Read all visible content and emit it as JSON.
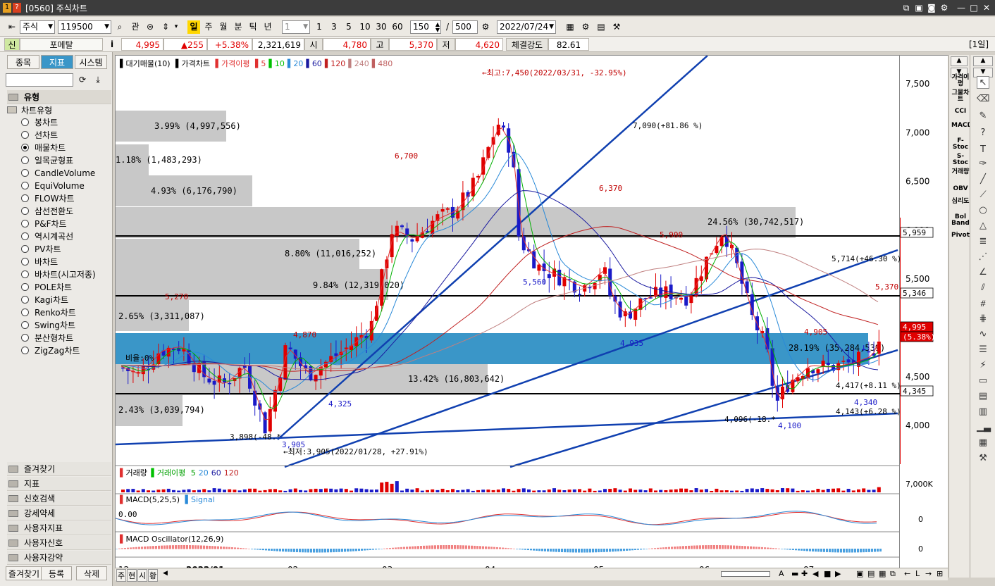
{
  "window": {
    "title": "[0560] 주식차트",
    "badge1": "1",
    "badge2": "?",
    "icons": [
      "restore-icon",
      "window-icon",
      "capture-icon",
      "settings-icon",
      "minimize",
      "maximize",
      "close"
    ]
  },
  "toolbar": {
    "market": "주식",
    "code": "119500",
    "search_btn": "관",
    "periods": [
      "일",
      "주",
      "월",
      "분",
      "틱",
      "년"
    ],
    "interval": "1",
    "quick": [
      "1",
      "3",
      "5",
      "10",
      "30",
      "60"
    ],
    "count": "150",
    "total": "500",
    "date": "2022/07/24"
  },
  "quote": {
    "badge": "신",
    "name": "포메탈",
    "info": "i",
    "price": "4,995",
    "change": "▲255",
    "pct": "+5.38%",
    "volume": "2,321,619",
    "open_label": "시",
    "open": "4,780",
    "high_label": "고",
    "high": "5,370",
    "low_label": "저",
    "low": "4,620",
    "strength_label": "체결강도",
    "strength": "82.61",
    "period_label": "[1일]"
  },
  "left": {
    "tabs": [
      "종목",
      "지표",
      "시스템"
    ],
    "section": "유형",
    "tree_label": "차트유형",
    "types": [
      "봉차트",
      "선차트",
      "매물차트",
      "일목균형표",
      "CandleVolume",
      "EquiVolume",
      "FLOW차트",
      "삼선전환도",
      "P&F차트",
      "역시계곡선",
      "PV차트",
      "바차트",
      "바차트(시고저종)",
      "POLE차트",
      "Kagi차트",
      "Renko차트",
      "Swing차트",
      "분산형차트",
      "ZigZag차트"
    ],
    "selected": "매물차트",
    "categories": [
      "즐겨찾기",
      "지표",
      "신호검색",
      "강세약세",
      "사용자지표",
      "사용자신호",
      "사용자강약"
    ],
    "bottom_tabs": [
      "즐겨찾기",
      "등록",
      "삭제"
    ]
  },
  "legend": {
    "main": "대기매물(10)",
    "price": "가격차트",
    "ma_label": "가격이평",
    "ma": [
      "5",
      "10",
      "20",
      "60",
      "120",
      "240",
      "480"
    ],
    "ma_colors": [
      "#e03030",
      "#00c000",
      "#2a8ad8",
      "#1a1aa0",
      "#c02020",
      "#c08080",
      "#c06060"
    ],
    "vol": "거래량",
    "vol_ma_label": "거래이평",
    "vol_ma": [
      "5",
      "20",
      "60",
      "120"
    ],
    "macd": "MACD(5,25,5)",
    "signal": "Signal",
    "osc": "MACD Oscillator(12,26,9)"
  },
  "annotations": {
    "high": "←최고:7,450(2022/03/31, -32.95%)",
    "low": "←최저:3,905(2022/01/28, +27.91%)",
    "l6700": "6,700",
    "l6370": "6,370",
    "l5900": "5,900",
    "l5560": "5,560",
    "l5270": "5,270",
    "l4870": "4,870",
    "l4935": "4,935",
    "l4905": "4,905",
    "l4325": "4,325",
    "l3905": "3,905",
    "l4100": "4,100",
    "l4340": "4,340",
    "l5370": "5,370",
    "t7090": "7,090(+81.86 %)",
    "t5714": "5,714(+46.30 %)",
    "t4417": "4,417(+8.11 %)",
    "t4143": "4,143(+6.28 %)",
    "t4096": "4,096(-18.*",
    "t3898": "3,898(-48.*",
    "ratio": "비율:0%",
    "macd_zero": "0.00"
  },
  "volume_profile": [
    {
      "text": "3.99% (4,997,556)"
    },
    {
      "text": "1.18% (1,483,293)"
    },
    {
      "text": "4.93% (6,176,790)"
    },
    {
      "text": "24.56% (30,742,517)"
    },
    {
      "text": "8.80% (11,016,252)"
    },
    {
      "text": "9.84% (12,319,020)"
    },
    {
      "text": "2.65% (3,311,087)"
    },
    {
      "text": "28.19% (35,284,539)"
    },
    {
      "text": "13.42% (16,803,642)"
    },
    {
      "text": "2.43% (3,039,794)"
    }
  ],
  "axis": {
    "prices": [
      "7,500",
      "7,000",
      "6,500",
      "6,000",
      "5,500",
      "5,000",
      "4,500",
      "4,000"
    ],
    "markers": [
      "5,959",
      "5,346",
      "4,995",
      "(5.38%)",
      "4,345"
    ],
    "vol": "7,000K",
    "macd": "0",
    "osc": "0",
    "months": [
      "12",
      "2022/01",
      "02",
      "03",
      "04",
      "05",
      "06",
      "07"
    ]
  },
  "right_indicators": [
    "가격이평",
    "그물차트",
    "CCI",
    "MACD",
    "F-Stoc",
    "S-Stoc",
    "거래량",
    "OBV",
    "심리도",
    "Bol Band",
    "Pivot"
  ],
  "bottom": {
    "tabs": [
      "주",
      "현",
      "시",
      "황"
    ]
  },
  "colors": {
    "up": "#e00000",
    "down": "#1a1ac8",
    "band": "#3a96c8",
    "gray": "#c8c8c8",
    "trend": "#1040b0"
  }
}
